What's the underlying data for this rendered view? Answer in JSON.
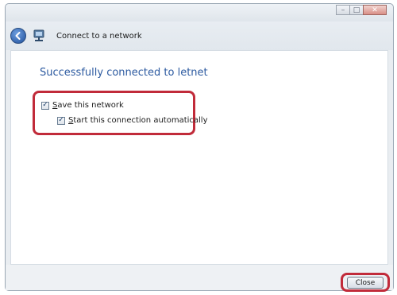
{
  "window": {
    "controls": {
      "minimize": "–",
      "maximize": "□",
      "close": "✕"
    }
  },
  "nav": {
    "title": "Connect to a network",
    "back_icon": "back-arrow-icon",
    "network_icon": "network-icon"
  },
  "main": {
    "heading": "Successfully connected to letnet",
    "options": [
      {
        "label_first": "S",
        "label_rest": "ave this network",
        "checked": true
      },
      {
        "label_first": "S",
        "label_rest": "tart this connection automatically",
        "checked": true
      }
    ]
  },
  "footer": {
    "close_label": "Close"
  },
  "colors": {
    "highlight": "#c12b3a",
    "heading": "#2c5aa0"
  }
}
